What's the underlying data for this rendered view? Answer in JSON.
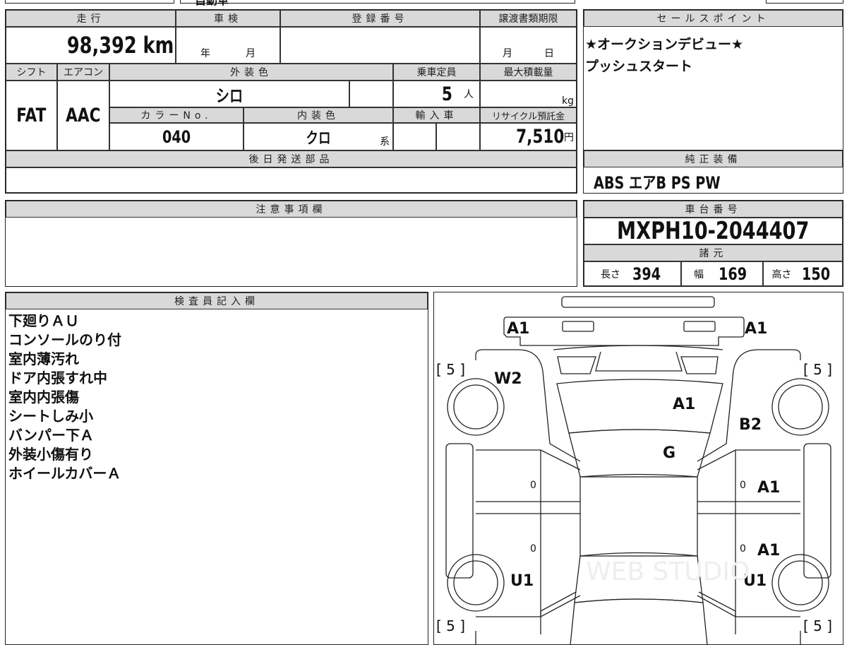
{
  "top": {
    "cut_text": "自動車"
  },
  "main": {
    "mileage_label": "走行",
    "mileage": "98,392",
    "mileage_unit": "km",
    "inspection_label": "車検",
    "inspection_year": "年",
    "inspection_month": "月",
    "registration_label": "登録番号",
    "registration": "",
    "transfer_label": "譲渡書類期限",
    "transfer_month": "月",
    "transfer_day": "日",
    "shift_label": "シフト",
    "shift": "FAT",
    "ac_label": "エアコン",
    "ac": "AAC",
    "exterior_label": "外装色",
    "exterior": "シロ",
    "capacity_label": "乗車定員",
    "capacity": "5",
    "capacity_unit": "人",
    "load_label": "最大積載量",
    "load_unit": "kg",
    "color_no_label": "カラーNo.",
    "color_no": "040",
    "interior_label": "内装色",
    "interior": "クロ",
    "interior_suffix": "系",
    "import_label": "輸入車",
    "recycle_label": "リサイクル預託金",
    "recycle": "7,510",
    "recycle_unit": "円",
    "parts_label": "後日発送部品"
  },
  "sales": {
    "label": "セールスポイント",
    "lines": [
      "★オークションデビュー★",
      "プッシュスタート"
    ]
  },
  "equipment": {
    "label": "純正装備",
    "value": "ABS エアB PS PW"
  },
  "caution": {
    "label": "注意事項欄"
  },
  "chassis": {
    "label": "車台番号",
    "value": "MXPH10-2044407",
    "spec_label": "諸元",
    "length_label": "長さ",
    "length": "394",
    "width_label": "幅",
    "width": "169",
    "height_label": "高さ",
    "height": "150"
  },
  "inspector": {
    "label": "検査員記入欄",
    "notes": [
      "下廻りＡＵ",
      "コンソールのり付",
      "室内薄汚れ",
      "ドア内張すれ中",
      "室内内張傷",
      "シートしみ小",
      "バンパー下Ａ",
      "外装小傷有り",
      "ホイールカバーＡ"
    ]
  },
  "diagram": {
    "marks": {
      "front_left": "A1",
      "front_right": "A1",
      "fender_left": "W2",
      "hood": "A1",
      "fender_right": "B2",
      "windshield": "G",
      "door_fr": "A1",
      "door_rr": "A1",
      "quarter_left": "U1",
      "quarter_right": "U1",
      "door_fl_small": "0",
      "door_rl_small": "0",
      "door_fr_small": "0",
      "door_rr_small": "0"
    },
    "tire_fl": "[ 5 ]",
    "tire_fr": "[ 5 ]",
    "tire_rl": "[ 5 ]",
    "tire_rr": "[ 5 ]",
    "watermark": "WEB STUDIO"
  }
}
